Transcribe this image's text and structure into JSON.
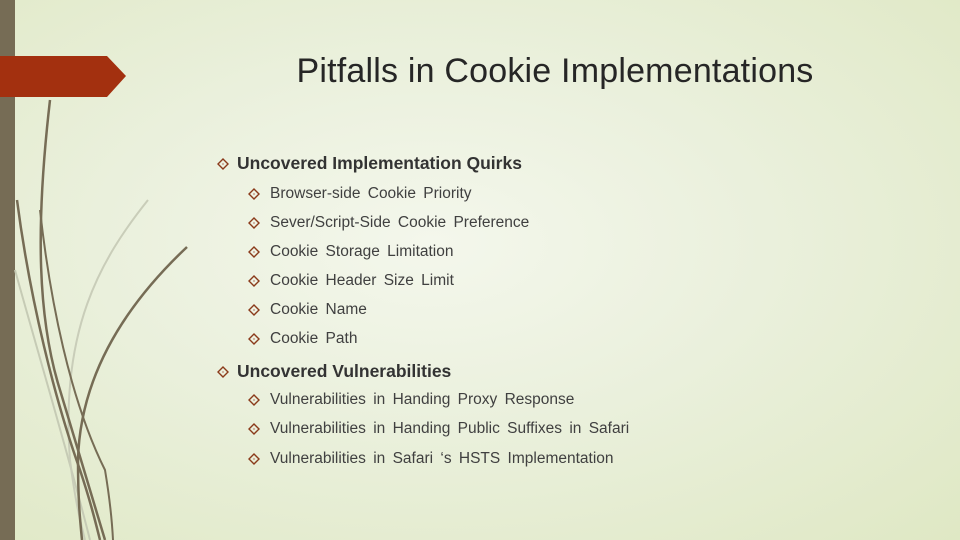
{
  "slide": {
    "title": "Pitfalls in Cookie Implementations",
    "colors": {
      "accent": "#a3300f",
      "sidebar": "#766c55",
      "text": "#262626",
      "bullet": "#8a3a1a"
    },
    "sections": [
      {
        "heading": "Uncovered Implementation Quirks",
        "bullet_icon": "diamond-bullet-icon",
        "items": [
          "Browser-side Cookie Priority",
          "Sever/Script-Side Cookie  Preference",
          "Cookie  Storage  Limitation",
          "Cookie  Header  Size  Limit",
          "Cookie  Name",
          "Cookie  Path"
        ]
      },
      {
        "heading": "Uncovered  Vulnerabilities",
        "bullet_icon": "diamond-bullet-icon",
        "items": [
          "Vulnerabilities  in Handing Proxy Response",
          "Vulnerabilities  in  Handing  Public  Suffixes  in  Safari",
          "Vulnerabilities  in  Safari  ‘s  HSTS  Implementation"
        ]
      }
    ]
  }
}
